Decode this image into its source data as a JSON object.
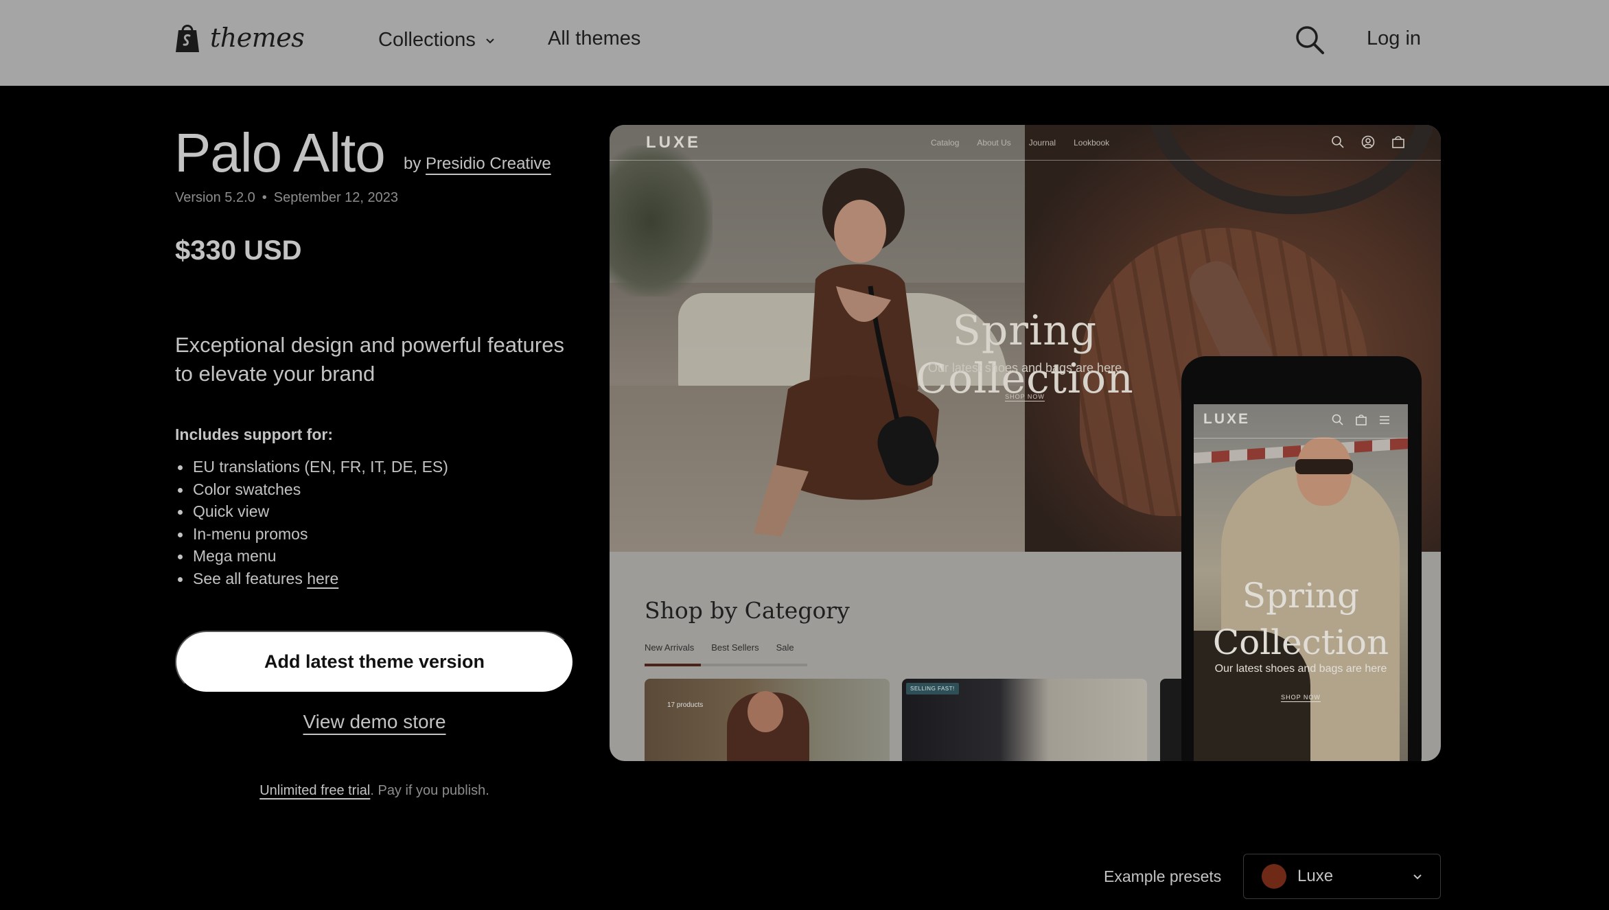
{
  "nav": {
    "logo_text": "themes",
    "collections": "Collections",
    "all_themes": "All themes",
    "login": "Log in",
    "icons": [
      "shopify-bag-icon",
      "chevron-down-icon",
      "search-icon"
    ]
  },
  "theme": {
    "name": "Palo Alto",
    "by": "by",
    "author": "Presidio Creative",
    "version": "Version 5.2.0",
    "separator": "•",
    "date": "September 12, 2023",
    "price": "$330 USD",
    "tagline": "Exceptional design and powerful features to elevate your brand",
    "support_title": "Includes support for:",
    "features": [
      "EU translations (EN, FR, IT, DE, ES)",
      "Color swatches",
      "Quick view",
      "In-menu promos",
      "Mega menu"
    ],
    "see_all_prefix": "See all features ",
    "see_all_link": "here",
    "cta": "Add latest theme version",
    "demo": "View demo store",
    "trial_link": "Unlimited free trial",
    "trial_rest": ". Pay if you publish."
  },
  "preview": {
    "logo": "LUXE",
    "menu": [
      "Catalog",
      "About Us",
      "Journal",
      "Lookbook"
    ],
    "hero_title": "Spring Collection",
    "hero_sub": "Our latest shoes and bags are here",
    "hero_cta": "SHOP NOW",
    "section_title": "Shop by Category",
    "tabs": [
      "New Arrivals",
      "Best Sellers",
      "Sale"
    ],
    "card1_label": "17 products",
    "card2_badge": "SELLING FAST!",
    "mobile": {
      "logo": "LUXE",
      "title_line1": "Spring",
      "title_line2": "Collection",
      "sub": "Our latest shoes and bags are here",
      "cta": "SHOP NOW"
    }
  },
  "presets": {
    "label": "Example presets",
    "selected": "Luxe",
    "swatch_color": "#6e2a17"
  }
}
